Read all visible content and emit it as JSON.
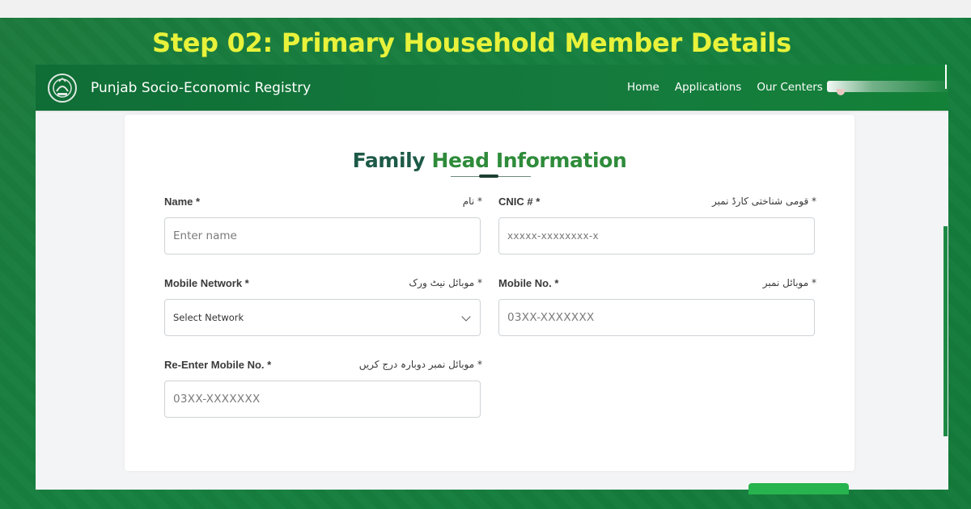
{
  "banner": {
    "title": "Step 02: Primary Household Member Details"
  },
  "navbar": {
    "brand": "Punjab Socio-Economic Registry",
    "links": [
      "Home",
      "Applications",
      "Our Centers"
    ]
  },
  "form": {
    "title_part1": "Family",
    "title_part2": "Head Information",
    "fields": {
      "name": {
        "label": "Name *",
        "label_urdu": "* نام",
        "placeholder": "Enter name"
      },
      "cnic": {
        "label": "CNIC # *",
        "label_urdu": "* قومی شناختی کارڈ نمبر",
        "placeholder": "xxxxx-xxxxxxxx-x"
      },
      "mobile_network": {
        "label": "Mobile Network *",
        "label_urdu": "* موبائل نیٹ ورک",
        "selected": "Select Network"
      },
      "mobile_no": {
        "label": "Mobile No. *",
        "label_urdu": "* موبائل نمبر",
        "placeholder": "03XX-XXXXXXX"
      },
      "re_mobile_no": {
        "label": "Re-Enter Mobile No. *",
        "label_urdu": "* موبائل نمبر دوبارہ درج کریں",
        "placeholder": "03XX-XXXXXXX"
      }
    }
  },
  "colors": {
    "banner_text": "#e8f23a",
    "frame_green": "#168040",
    "title_dark": "#1d5a47",
    "title_green": "#2e8b3a",
    "button_green": "#27b34d"
  }
}
